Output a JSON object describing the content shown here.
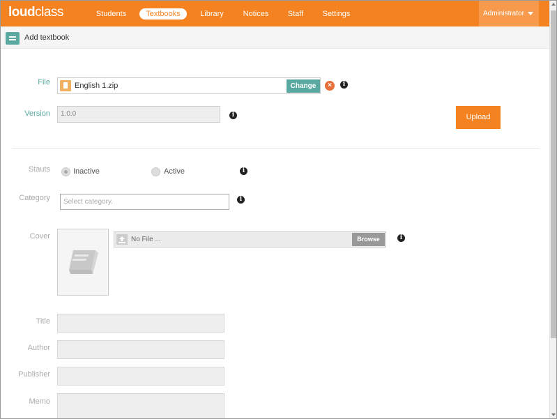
{
  "app": {
    "logo_bold": "loud",
    "logo_light": "class"
  },
  "nav": {
    "items": [
      {
        "label": "Students"
      },
      {
        "label": "Textbooks",
        "active": true
      },
      {
        "label": "Library"
      },
      {
        "label": "Notices"
      },
      {
        "label": "Staff"
      },
      {
        "label": "Settings"
      }
    ],
    "user": "Administrator"
  },
  "subheader": {
    "title": "Add textbook"
  },
  "form": {
    "file_label": "File",
    "file_name": "English 1.zip",
    "change_label": "Change",
    "version_label": "Version",
    "version_value": "1.0.0",
    "upload_label": "Upload",
    "status_label": "Stauts",
    "status_options": [
      "Inactive",
      "Active"
    ],
    "status_selected": "Inactive",
    "category_label": "Category",
    "category_placeholder": "Select category.",
    "cover_label": "Cover",
    "cover_file": "No File ...",
    "browse_label": "Browse",
    "title_label": "Title",
    "author_label": "Author",
    "publisher_label": "Publisher",
    "memo_label": "Memo"
  },
  "icons": {
    "info": "info-icon",
    "remove": "remove-icon",
    "file": "zip-file-icon",
    "menu": "menu-icon",
    "upload": "upload-icon",
    "book": "book-placeholder-icon"
  },
  "colors": {
    "brand": "#f58220",
    "accent": "#5aa9a0"
  }
}
